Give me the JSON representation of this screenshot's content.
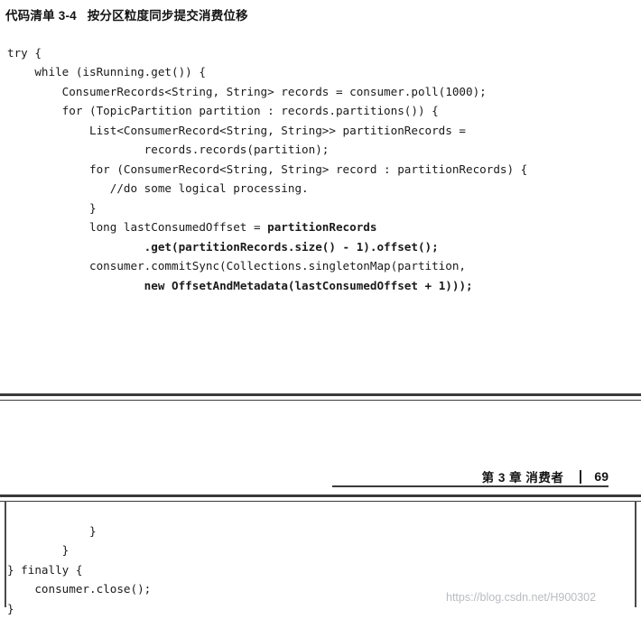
{
  "caption": "代码清单 3-4   按分区粒度同步提交消费位移",
  "code_top": [
    {
      "indent": 0,
      "segments": [
        {
          "t": "try {",
          "bold": false
        }
      ]
    },
    {
      "indent": 1,
      "segments": [
        {
          "t": "while (isRunning.get()) {",
          "bold": false
        }
      ]
    },
    {
      "indent": 2,
      "segments": [
        {
          "t": "ConsumerRecords<String, String> records = consumer.poll(1000);",
          "bold": false
        }
      ]
    },
    {
      "indent": 2,
      "segments": [
        {
          "t": "for (TopicPartition partition : records.partitions()) {",
          "bold": false
        }
      ]
    },
    {
      "indent": 3,
      "segments": [
        {
          "t": "List<ConsumerRecord<String, String>> partitionRecords =",
          "bold": false
        }
      ]
    },
    {
      "indent": 4,
      "segments": [
        {
          "t": "    records.records(partition);",
          "bold": false
        }
      ]
    },
    {
      "indent": 3,
      "segments": [
        {
          "t": "for (ConsumerRecord<String, String> record : partitionRecords) {",
          "bold": false
        }
      ]
    },
    {
      "indent": 3,
      "segments": [
        {
          "t": "   //do some logical processing.",
          "bold": false
        }
      ]
    },
    {
      "indent": 3,
      "segments": [
        {
          "t": "}",
          "bold": false
        }
      ]
    },
    {
      "indent": 3,
      "segments": [
        {
          "t": "long lastConsumedOffset = ",
          "bold": false
        },
        {
          "t": "partitionRecords",
          "bold": true
        }
      ]
    },
    {
      "indent": 4,
      "segments": [
        {
          "t": "    ",
          "bold": false
        },
        {
          "t": ".get(partitionRecords.size() - 1).offset();",
          "bold": true
        }
      ]
    },
    {
      "indent": 3,
      "segments": [
        {
          "t": "consumer.commitSync(Collections.singletonMap(partition,",
          "bold": false
        }
      ]
    },
    {
      "indent": 4,
      "segments": [
        {
          "t": "    ",
          "bold": false
        },
        {
          "t": "new OffsetAndMetadata(lastConsumedOffset + 1)));",
          "bold": true
        }
      ]
    }
  ],
  "code_bottom": [
    {
      "indent": 3,
      "segments": [
        {
          "t": "}",
          "bold": false
        }
      ]
    },
    {
      "indent": 2,
      "segments": [
        {
          "t": "}",
          "bold": false
        }
      ]
    },
    {
      "indent": 0,
      "segments": [
        {
          "t": "} finally {",
          "bold": false
        }
      ]
    },
    {
      "indent": 1,
      "segments": [
        {
          "t": "consumer.close();",
          "bold": false
        }
      ]
    },
    {
      "indent": 0,
      "segments": [
        {
          "t": "}",
          "bold": false
        }
      ]
    }
  ],
  "footer": {
    "chapter": "第 3 章   消费者",
    "page_number": "69"
  },
  "watermark": "https://blog.csdn.net/H900302",
  "ghost_text": "  "
}
